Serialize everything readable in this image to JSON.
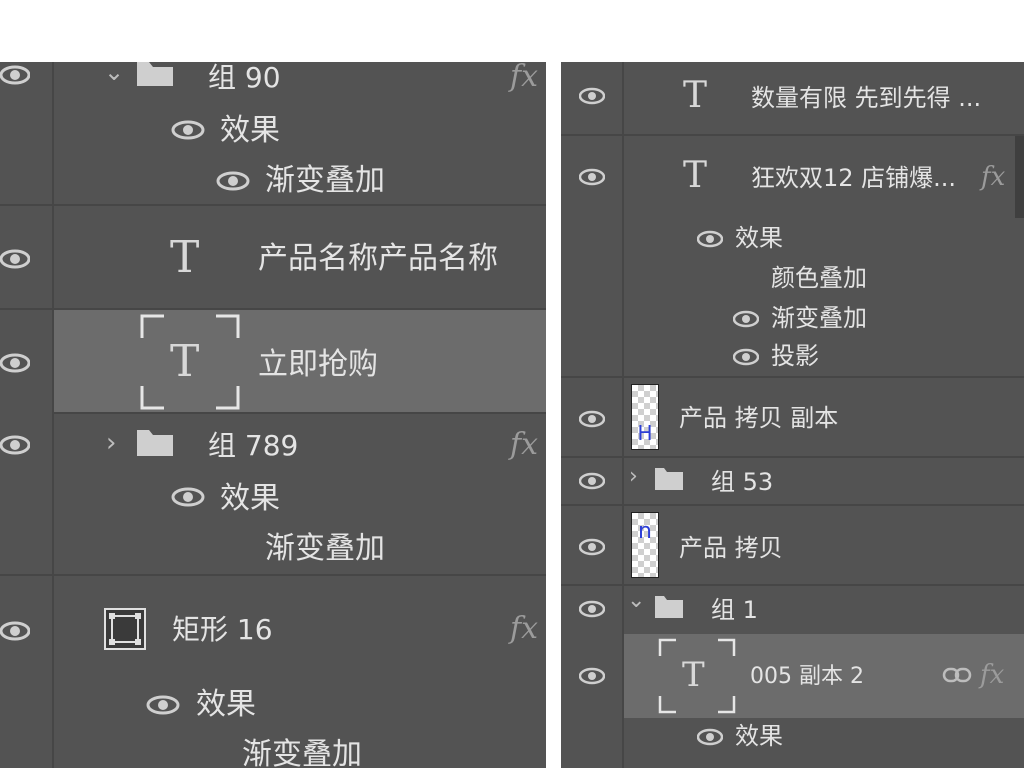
{
  "colors": {
    "panel_bg": "#535353",
    "selected_row": "#6c6c6c",
    "separator": "#464646",
    "text": "#e4e4e4",
    "fx": "#9b9b9b"
  },
  "icons": {
    "eye": "eye-icon",
    "folder": "folder-icon",
    "text_layer": "text-layer-icon",
    "shape_layer": "rectangle-shape-icon",
    "fx": "fx-icon",
    "link": "link-icon"
  },
  "left_panel": {
    "group90": {
      "name": "组 90",
      "fx": "fx",
      "effects": "效果",
      "gradient": "渐变叠加"
    },
    "product_name": {
      "name": "产品名称产品名称",
      "glyph": "T"
    },
    "buy_now": {
      "name": "立即抢购",
      "glyph": "T"
    },
    "group789": {
      "name": "组 789",
      "fx": "fx",
      "effects": "效果",
      "gradient": "渐变叠加"
    },
    "rect16": {
      "name": "矩形 16",
      "fx": "fx",
      "effects": "效果",
      "gradient": "渐变叠加"
    }
  },
  "right_panel": {
    "limited": {
      "name": "数量有限 先到先得 ...",
      "glyph": "T"
    },
    "carnival": {
      "name": "狂欢双12 店铺爆...",
      "fx": "fx",
      "glyph": "T",
      "effects": "效果",
      "color_overlay": "颜色叠加",
      "gradient": "渐变叠加",
      "shadow": "投影"
    },
    "product_copy_copy": {
      "name": "产品 拷贝 副本",
      "thumb": "H"
    },
    "group53": {
      "name": "组 53"
    },
    "product_copy": {
      "name": "产品 拷贝",
      "thumb": "n"
    },
    "group1": {
      "name": "组 1"
    },
    "copy005": {
      "name": "005 副本 2",
      "fx": "fx",
      "glyph": "T",
      "effects": "效果"
    }
  }
}
